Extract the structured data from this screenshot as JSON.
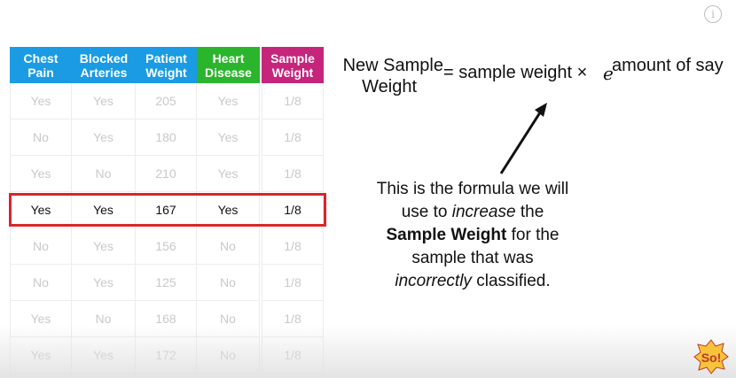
{
  "table": {
    "headers": [
      {
        "label": "Chest Pain",
        "color": "#1a9be4"
      },
      {
        "label": "Blocked Arteries",
        "color": "#1a9be4"
      },
      {
        "label": "Patient Weight",
        "color": "#1a9be4"
      },
      {
        "label": "Heart Disease",
        "color": "#2bb52c"
      }
    ],
    "rows": [
      [
        "Yes",
        "Yes",
        "205",
        "Yes"
      ],
      [
        "No",
        "Yes",
        "180",
        "Yes"
      ],
      [
        "Yes",
        "No",
        "210",
        "Yes"
      ],
      [
        "Yes",
        "Yes",
        "167",
        "Yes"
      ],
      [
        "No",
        "Yes",
        "156",
        "No"
      ],
      [
        "No",
        "Yes",
        "125",
        "No"
      ],
      [
        "Yes",
        "No",
        "168",
        "No"
      ],
      [
        "Yes",
        "Yes",
        "172",
        "No"
      ]
    ],
    "highlighted_row_index": 3,
    "highlight_color": "#d8262a"
  },
  "sample_weight": {
    "header": "Sample Weight",
    "color": "#c5267c",
    "values": [
      "1/8",
      "1/8",
      "1/8",
      "1/8",
      "1/8",
      "1/8",
      "1/8",
      "1/8"
    ]
  },
  "formula": {
    "lhs_line1": "New Sample",
    "lhs_line2": "Weight",
    "rhs": "= sample weight ×",
    "base": "e",
    "exponent": "amount of say"
  },
  "explanation": {
    "line1": "This is the formula we will",
    "line2_pre": "use to ",
    "line2_em": "increase",
    "line2_post": " the",
    "line3_strong": "Sample Weight",
    "line3_post": " for the",
    "line4": "sample that was",
    "line5_em": "incorrectly",
    "line5_post": " classified."
  },
  "info_icon_label": "i",
  "logo_text": "So!"
}
